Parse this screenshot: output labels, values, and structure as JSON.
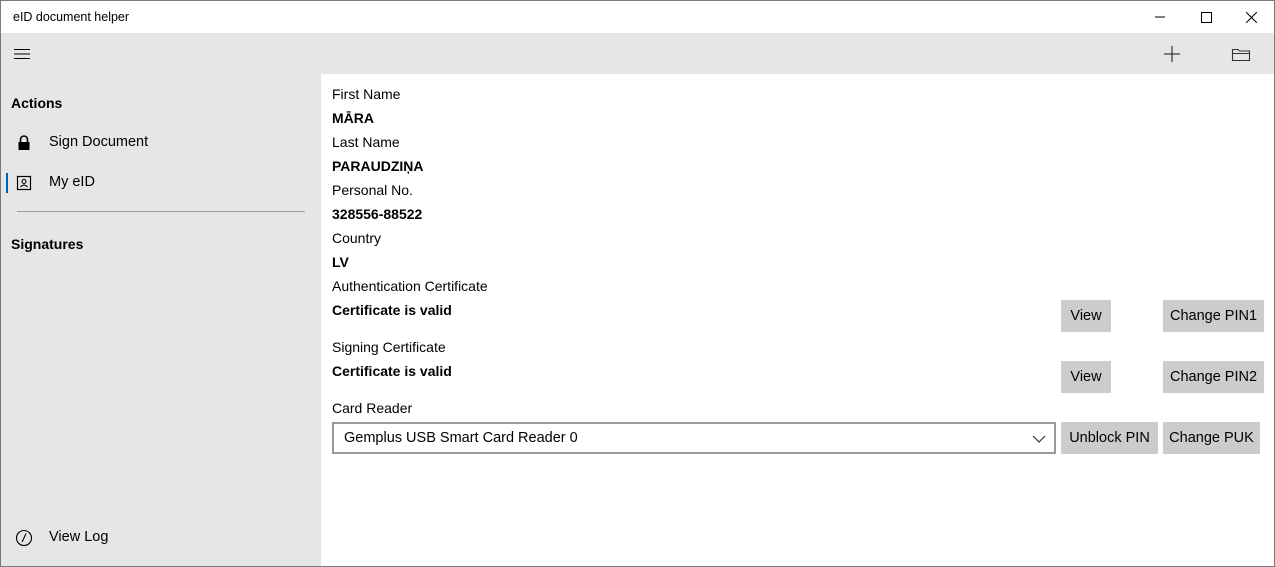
{
  "window": {
    "title": "eID document helper"
  },
  "toolbar": {
    "menu_icon": "hamburger-icon",
    "add_icon": "plus-icon",
    "open_icon": "folder-icon"
  },
  "sidebar": {
    "actions_heading": "Actions",
    "items": [
      {
        "label": "Sign Document",
        "icon": "lock-icon"
      },
      {
        "label": "My eID",
        "icon": "contact-card-icon",
        "selected": true
      }
    ],
    "signatures_heading": "Signatures",
    "view_log": {
      "label": "View Log",
      "icon": "gauge-icon"
    }
  },
  "eid": {
    "first_name_label": "First Name",
    "first_name": "MĀRA",
    "last_name_label": "Last Name",
    "last_name": "PARAUDZIŅA",
    "personal_no_label": "Personal No.",
    "personal_no": "328556-88522",
    "country_label": "Country",
    "country": "LV",
    "auth_cert_label": "Authentication Certificate",
    "auth_cert_status": "Certificate is valid",
    "sign_cert_label": "Signing Certificate",
    "sign_cert_status": "Certificate is valid",
    "card_reader_label": "Card Reader",
    "card_reader_selected": "Gemplus USB Smart Card Reader 0"
  },
  "buttons": {
    "view_auth": "View",
    "change_pin1": "Change PIN1",
    "view_sign": "View",
    "change_pin2": "Change PIN2",
    "unblock_pin": "Unblock PIN",
    "change_puk": "Change PUK"
  },
  "colors": {
    "accent": "#0063b1",
    "pane_bg": "#e6e6e6",
    "button_bg": "#cccccc"
  }
}
